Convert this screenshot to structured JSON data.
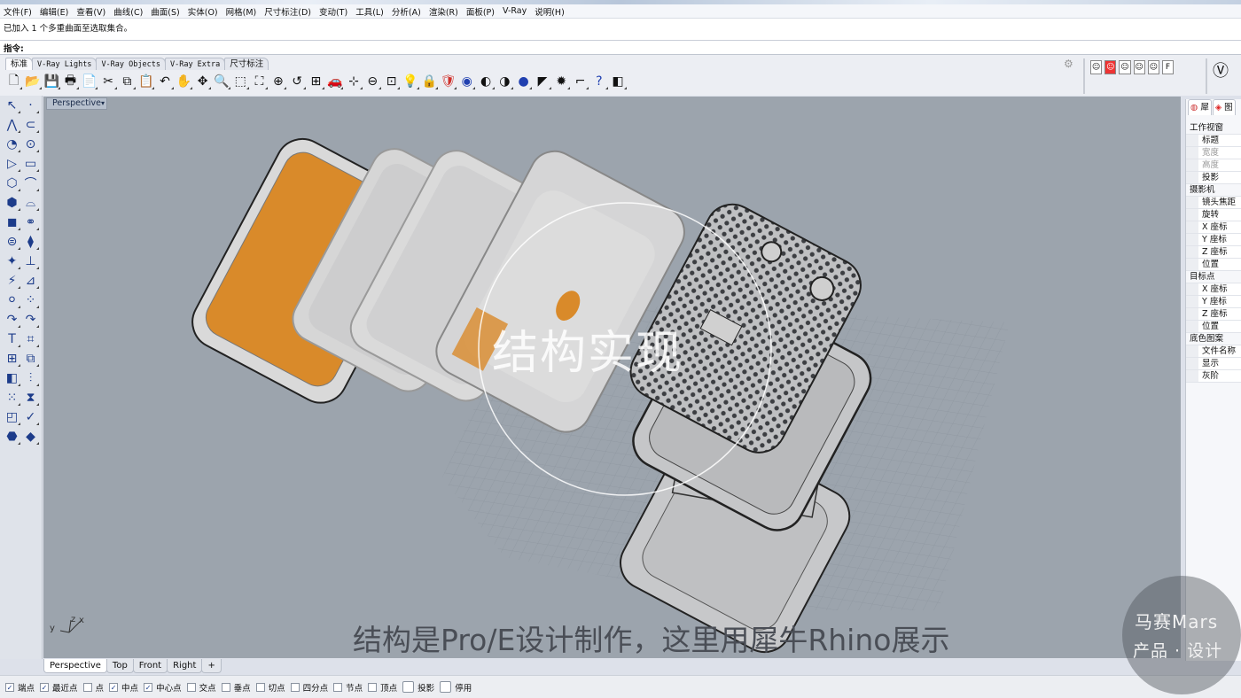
{
  "menu": [
    "文件(F)",
    "编辑(E)",
    "查看(V)",
    "曲线(C)",
    "曲面(S)",
    "实体(O)",
    "网格(M)",
    "尺寸标注(D)",
    "变动(T)",
    "工具(L)",
    "分析(A)",
    "渲染(R)",
    "面板(P)",
    "V-Ray",
    "说明(H)"
  ],
  "history": {
    "line1": "已加入 1 个多重曲面至选取集合。"
  },
  "command": {
    "label": "指令:",
    "value": ""
  },
  "toolbar_tabs": [
    "标准",
    "V-Ray Lights",
    "V-Ray Objects",
    "V-Ray Extra",
    "尺寸标注"
  ],
  "toolbar_icons": [
    "new-file-icon",
    "open-folder-icon",
    "save-icon",
    "print-icon",
    "import-icon",
    "cut-icon",
    "copy-icon",
    "paste-icon",
    "undo-icon",
    "pan-hand-icon",
    "rotate-view-icon",
    "zoom-icon",
    "zoom-window-icon",
    "zoom-extents-icon",
    "zoom-selected-icon",
    "undo-view-icon",
    "four-viewports-icon",
    "car-render-icon",
    "grid-options-icon",
    "osnap-circle-icon",
    "cplane-icon",
    "light-bulb-icon",
    "lock-icon",
    "layer-icon",
    "color-wheel-icon",
    "shaded-sphere-icon",
    "rendered-sphere-icon",
    "render-sphere-icon",
    "pointer-options-icon",
    "gear-settings-icon",
    "rectangle-options-icon",
    "help-icon",
    "flashlight-icon"
  ],
  "toolbar_glyphs": [
    "🗋",
    "📂",
    "💾",
    "🖶",
    "📄",
    "✂",
    "⧉",
    "📋",
    "↶",
    "✋",
    "✥",
    "🔍",
    "⬚",
    "⛶",
    "⊕",
    "↺",
    "⊞",
    "🚗",
    "⊹",
    "⊖",
    "⊡",
    "💡",
    "🔒",
    "🛡",
    "◉",
    "◐",
    "◑",
    "●",
    "◤",
    "✹",
    "⌐",
    "?",
    "◧"
  ],
  "right_tools": [
    "viewport-capture-icon",
    "no-capture-icon",
    "image-icon",
    "face-icon",
    "bitmap-icon",
    "f-icon"
  ],
  "left_tools": [
    [
      "↖",
      "·"
    ],
    [
      "⋀",
      "⊂"
    ],
    [
      "◔",
      "⊙"
    ],
    [
      "▷",
      "▭"
    ],
    [
      "⬡",
      "⌒"
    ],
    [
      "⬢",
      "⌓"
    ],
    [
      "◼",
      "⚭"
    ],
    [
      "⊜",
      "⧫"
    ],
    [
      "✦",
      "⊥"
    ],
    [
      "⚡",
      "⊿"
    ],
    [
      "⚪",
      "⁘"
    ],
    [
      "↷",
      "↷"
    ],
    [
      "T",
      "⌗"
    ],
    [
      "⊞",
      "⧉"
    ],
    [
      "◧",
      "⫶"
    ],
    [
      "⁙",
      "⧗"
    ],
    [
      "◰",
      "✓"
    ],
    [
      "⬣",
      "◆"
    ]
  ],
  "viewport": {
    "name": "Perspective",
    "axis_label": {
      "x": "x",
      "y": "y",
      "z": "z"
    }
  },
  "watermark": "结构实现",
  "subtitle": "结构是Pro/E设计制作，这里用犀牛Rhino展示",
  "properties_panel": {
    "tabs": [
      "犀",
      "图"
    ],
    "rows": [
      {
        "type": "group",
        "label": "工作视窗"
      },
      {
        "type": "item",
        "label": "标题"
      },
      {
        "type": "item",
        "label": "宽度",
        "dim": true
      },
      {
        "type": "item",
        "label": "高度",
        "dim": true
      },
      {
        "type": "item",
        "label": "投影"
      },
      {
        "type": "group",
        "label": "摄影机"
      },
      {
        "type": "item",
        "label": "镜头焦距"
      },
      {
        "type": "item",
        "label": "旋转"
      },
      {
        "type": "item",
        "label": "X 座标"
      },
      {
        "type": "item",
        "label": "Y 座标"
      },
      {
        "type": "item",
        "label": "Z 座标"
      },
      {
        "type": "item",
        "label": "位置"
      },
      {
        "type": "group",
        "label": "目标点"
      },
      {
        "type": "item",
        "label": "X 座标"
      },
      {
        "type": "item",
        "label": "Y 座标"
      },
      {
        "type": "item",
        "label": "Z 座标"
      },
      {
        "type": "item",
        "label": "位置"
      },
      {
        "type": "group",
        "label": "底色图案"
      },
      {
        "type": "item",
        "label": "文件名称"
      },
      {
        "type": "item",
        "label": "显示"
      },
      {
        "type": "item",
        "label": "灰阶"
      }
    ]
  },
  "viewport_tabs": [
    "Perspective",
    "Top",
    "Front",
    "Right",
    "+"
  ],
  "osnaps": [
    {
      "label": "端点",
      "checked": true
    },
    {
      "label": "最近点",
      "checked": true
    },
    {
      "label": "点",
      "checked": false
    },
    {
      "label": "中点",
      "checked": true
    },
    {
      "label": "中心点",
      "checked": true
    },
    {
      "label": "交点",
      "checked": false
    },
    {
      "label": "垂点",
      "checked": false
    },
    {
      "label": "切点",
      "checked": false
    },
    {
      "label": "四分点",
      "checked": false
    },
    {
      "label": "节点",
      "checked": false
    },
    {
      "label": "顶点",
      "checked": false
    },
    {
      "label": "投影",
      "checked": false,
      "big": true
    },
    {
      "label": "停用",
      "checked": false,
      "big": true
    }
  ],
  "brand": {
    "line1": "马赛Mars",
    "line2": "产品 · 设计"
  },
  "colors": {
    "viewport_bg": "#9ca4ad",
    "accent_orange": "#d98a2a",
    "part_gray": "#d4d5d6"
  }
}
